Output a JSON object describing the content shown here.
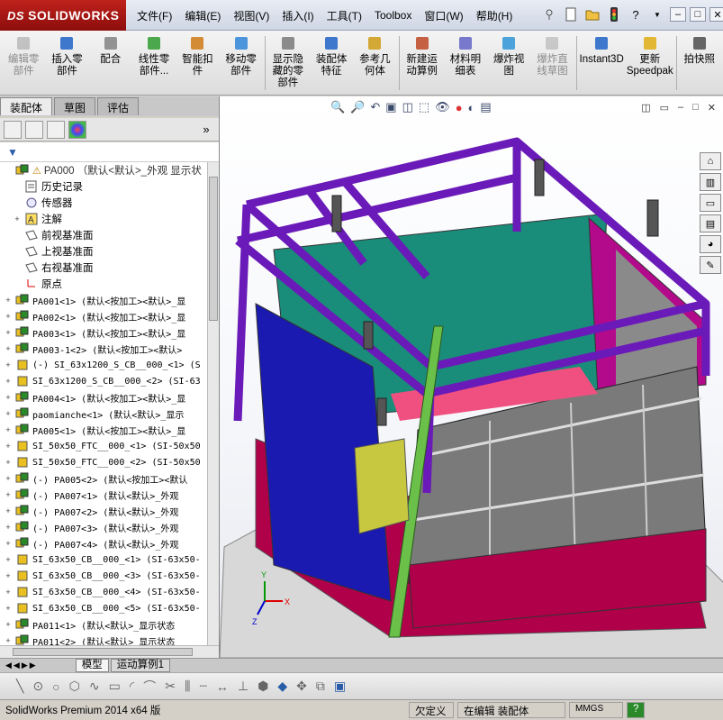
{
  "app": {
    "brand": "SOLIDWORKS",
    "brand_prefix": "DS"
  },
  "menu": [
    "文件(F)",
    "编辑(E)",
    "视图(V)",
    "插入(I)",
    "工具(T)",
    "Toolbox",
    "窗口(W)",
    "帮助(H)"
  ],
  "ribbon": [
    {
      "label": "编辑零部件",
      "disabled": true,
      "icon": "edit-component-icon"
    },
    {
      "label": "插入零部件",
      "disabled": false,
      "icon": "insert-component-icon"
    },
    {
      "label": "配合",
      "disabled": false,
      "icon": "mate-icon"
    },
    {
      "label": "线性零部件...",
      "disabled": false,
      "icon": "linear-pattern-icon"
    },
    {
      "label": "智能扣件",
      "disabled": false,
      "icon": "smart-fastener-icon"
    },
    {
      "label": "移动零部件",
      "disabled": false,
      "icon": "move-component-icon"
    },
    {
      "label": "显示隐藏的零部件",
      "disabled": false,
      "icon": "show-hidden-icon"
    },
    {
      "label": "装配体特征",
      "disabled": false,
      "icon": "assembly-feature-icon"
    },
    {
      "label": "参考几何体",
      "disabled": false,
      "icon": "reference-geometry-icon"
    },
    {
      "label": "新建运动算例",
      "disabled": false,
      "icon": "motion-study-icon"
    },
    {
      "label": "材料明细表",
      "disabled": false,
      "icon": "bom-icon"
    },
    {
      "label": "爆炸视图",
      "disabled": false,
      "icon": "exploded-view-icon"
    },
    {
      "label": "爆炸直线草图",
      "disabled": true,
      "icon": "explode-line-sketch-icon"
    },
    {
      "label": "Instant3D",
      "disabled": false,
      "icon": "instant3d-icon"
    },
    {
      "label": "更新Speedpak",
      "disabled": false,
      "icon": "speedpak-icon"
    },
    {
      "label": "拍快照",
      "disabled": false,
      "icon": "snapshot-icon"
    }
  ],
  "panel_tabs": [
    "装配体",
    "草图",
    "评估"
  ],
  "tree": [
    {
      "label": "PA000 （默认<默认>_外观 显示状",
      "icon": "assembly-icon",
      "expander": "",
      "warn": true
    },
    {
      "label": "历史记录",
      "icon": "history-icon",
      "expander": ""
    },
    {
      "label": "传感器",
      "icon": "sensor-icon",
      "expander": ""
    },
    {
      "label": "注解",
      "icon": "annotation-icon",
      "expander": "+"
    },
    {
      "label": "前视基准面",
      "icon": "plane-icon",
      "expander": ""
    },
    {
      "label": "上视基准面",
      "icon": "plane-icon",
      "expander": ""
    },
    {
      "label": "右视基准面",
      "icon": "plane-icon",
      "expander": ""
    },
    {
      "label": "原点",
      "icon": "origin-icon",
      "expander": ""
    },
    {
      "label": "PA001<1> (默认<按加工><默认>_显",
      "icon": "assembly-icon",
      "expander": "+"
    },
    {
      "label": "PA002<1> (默认<按加工><默认>_显",
      "icon": "assembly-icon",
      "expander": "+"
    },
    {
      "label": "PA003<1> (默认<按加工><默认>_显",
      "icon": "assembly-icon",
      "expander": "+"
    },
    {
      "label": "PA003-1<2> (默认<按加工><默认>",
      "icon": "assembly-icon",
      "expander": "+"
    },
    {
      "label": "(-) SI_63x1200_S_CB__000_<1> (S",
      "icon": "part-icon",
      "expander": "+"
    },
    {
      "label": "SI_63x1200_S_CB__000_<2> (SI-63",
      "icon": "part-icon",
      "expander": "+"
    },
    {
      "label": "PA004<1> (默认<按加工><默认>_显",
      "icon": "assembly-icon",
      "expander": "+"
    },
    {
      "label": "paomianche<1> (默认<默认>_显示",
      "icon": "assembly-icon",
      "expander": "+"
    },
    {
      "label": "PA005<1> (默认<按加工><默认>_显",
      "icon": "assembly-icon",
      "expander": "+"
    },
    {
      "label": "SI_50x50_FTC__000_<1> (SI-50x50",
      "icon": "part-icon",
      "expander": "+"
    },
    {
      "label": "SI_50x50_FTC__000_<2> (SI-50x50",
      "icon": "part-icon",
      "expander": "+"
    },
    {
      "label": "(-) PA005<2> (默认<按加工><默认",
      "icon": "assembly-icon",
      "expander": "+"
    },
    {
      "label": "(-) PA007<1> (默认<默认>_外观",
      "icon": "assembly-icon",
      "expander": "+"
    },
    {
      "label": "(-) PA007<2> (默认<默认>_外观",
      "icon": "assembly-icon",
      "expander": "+"
    },
    {
      "label": "(-) PA007<3> (默认<默认>_外观",
      "icon": "assembly-icon",
      "expander": "+"
    },
    {
      "label": "(-) PA007<4> (默认<默认>_外观",
      "icon": "assembly-icon",
      "expander": "+"
    },
    {
      "label": "SI_63x50_CB__000_<1> (SI-63x50-",
      "icon": "part-icon",
      "expander": "+"
    },
    {
      "label": "SI_63x50_CB__000_<3> (SI-63x50-",
      "icon": "part-icon",
      "expander": "+"
    },
    {
      "label": "SI_63x50_CB__000_<4> (SI-63x50-",
      "icon": "part-icon",
      "expander": "+"
    },
    {
      "label": "SI_63x50_CB__000_<5> (SI-63x50-",
      "icon": "part-icon",
      "expander": "+"
    },
    {
      "label": "PA011<1> (默认<默认>_显示状态",
      "icon": "assembly-icon",
      "expander": "+"
    },
    {
      "label": "PA011<2> (默认<默认>_显示状态",
      "icon": "assembly-icon",
      "expander": "+"
    }
  ],
  "bottom_tabs": [
    "模型",
    "运动算例1"
  ],
  "status": {
    "product": "SolidWorks Premium 2014 x64 版",
    "defined": "欠定义",
    "editing": "在编辑 装配体",
    "units": "MMGS",
    "help": "?"
  },
  "triad": {
    "x": "X",
    "y": "Y",
    "z": "Z"
  }
}
